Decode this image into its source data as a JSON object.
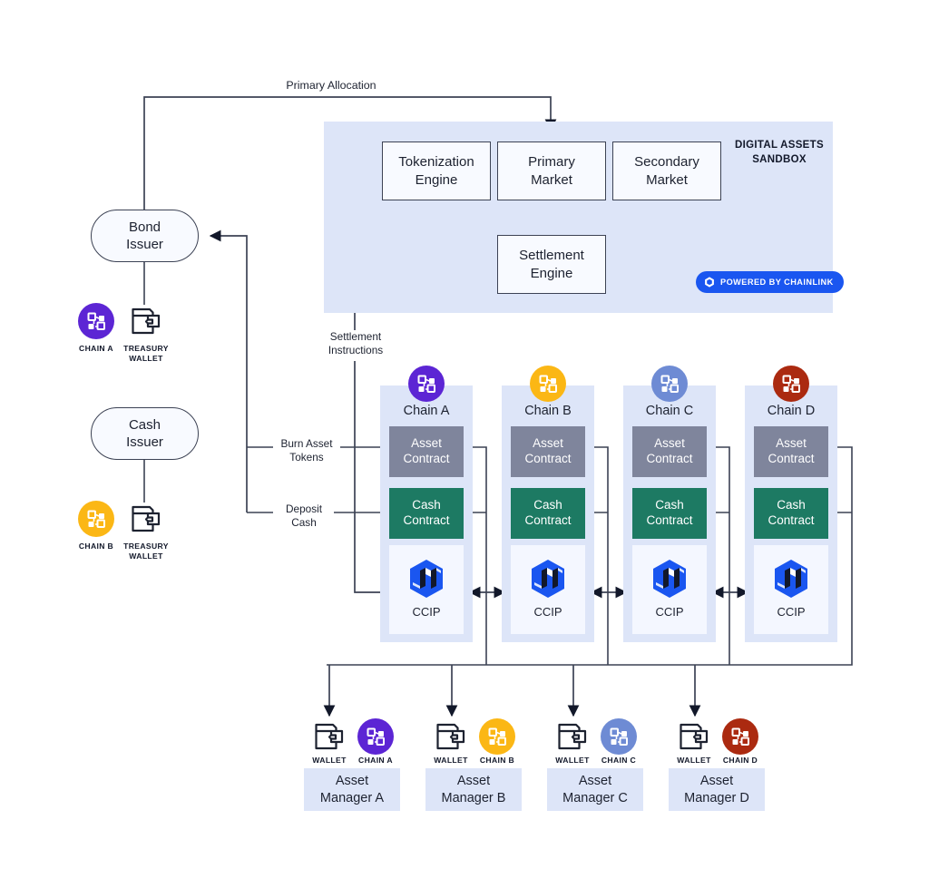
{
  "diagram": {
    "title": "Digital Assets Sandbox cross-chain bond settlement architecture"
  },
  "sandbox": {
    "title": "DIGITAL ASSETS\nSANDBOX",
    "title_line1": "DIGITAL ASSETS",
    "title_line2": "SANDBOX",
    "engines": [
      {
        "id": "tokenization-engine",
        "line1": "Tokenization",
        "line2": "Engine"
      },
      {
        "id": "primary-market",
        "line1": "Primary",
        "line2": "Market"
      },
      {
        "id": "secondary-market",
        "line1": "Secondary",
        "line2": "Market"
      },
      {
        "id": "settlement-engine",
        "line1": "Settlement",
        "line2": "Engine"
      }
    ],
    "badge": {
      "label": "POWERED BY CHAINLINK",
      "icon": "chainlink-hexagon-icon",
      "bg_color": "#1a56f0",
      "text_color": "#ffffff"
    }
  },
  "issuers": [
    {
      "id": "bond-issuer",
      "line1": "Bond",
      "line2": "Issuer",
      "chain_caption": "CHAIN A",
      "chain_color": "#5c25d4",
      "wallet_caption_line1": "TREASURY",
      "wallet_caption_line2": "WALLET"
    },
    {
      "id": "cash-issuer",
      "line1": "Cash",
      "line2": "Issuer",
      "chain_caption": "CHAIN B",
      "chain_color": "#fbb715",
      "wallet_caption_line1": "TREASURY",
      "wallet_caption_line2": "WALLET"
    }
  ],
  "chains": [
    {
      "id": "chain-a",
      "name": "Chain A",
      "chip_color": "#5c25d4",
      "asset_contract_line1": "Asset",
      "asset_contract_line2": "Contract",
      "cash_contract_line1": "Cash",
      "cash_contract_line2": "Contract",
      "ccip_label": "CCIP"
    },
    {
      "id": "chain-b",
      "name": "Chain B",
      "chip_color": "#fbb715",
      "asset_contract_line1": "Asset",
      "asset_contract_line2": "Contract",
      "cash_contract_line1": "Cash",
      "cash_contract_line2": "Contract",
      "ccip_label": "CCIP"
    },
    {
      "id": "chain-c",
      "name": "Chain C",
      "chip_color": "#6e8bd4",
      "asset_contract_line1": "Asset",
      "asset_contract_line2": "Contract",
      "cash_contract_line1": "Cash",
      "cash_contract_line2": "Contract",
      "ccip_label": "CCIP"
    },
    {
      "id": "chain-d",
      "name": "Chain D",
      "chip_color": "#ab2a10",
      "asset_contract_line1": "Asset",
      "asset_contract_line2": "Contract",
      "cash_contract_line1": "Cash",
      "cash_contract_line2": "Contract",
      "ccip_label": "CCIP"
    }
  ],
  "managers": [
    {
      "id": "asset-manager-a",
      "line1": "Asset",
      "line2": "Manager A",
      "wallet_caption": "WALLET",
      "chain_caption": "CHAIN A",
      "chain_color": "#5c25d4"
    },
    {
      "id": "asset-manager-b",
      "line1": "Asset",
      "line2": "Manager B",
      "wallet_caption": "WALLET",
      "chain_caption": "CHAIN B",
      "chain_color": "#fbb715"
    },
    {
      "id": "asset-manager-c",
      "line1": "Asset",
      "line2": "Manager C",
      "wallet_caption": "WALLET",
      "chain_caption": "CHAIN C",
      "chain_color": "#6e8bd4"
    },
    {
      "id": "asset-manager-d",
      "line1": "Asset",
      "line2": "Manager D",
      "wallet_caption": "WALLET",
      "chain_caption": "CHAIN D",
      "chain_color": "#ab2a10"
    }
  ],
  "edges": {
    "primary_allocation": "Primary Allocation",
    "settlement_instructions_line1": "Settlement",
    "settlement_instructions_line2": "Instructions",
    "burn_asset_tokens_line1": "Burn Asset",
    "burn_asset_tokens_line2": "Tokens",
    "deposit_cash_line1": "Deposit",
    "deposit_cash_line2": "Cash"
  },
  "colors": {
    "sandbox_bg": "#dde5f8",
    "box_border": "#3c4254",
    "asset_contract": "#7f859c",
    "cash_contract": "#1d7a63",
    "ccip_bg": "#f4f7ff",
    "chainlink_blue": "#1a56f0",
    "wire": "#3c4254"
  }
}
